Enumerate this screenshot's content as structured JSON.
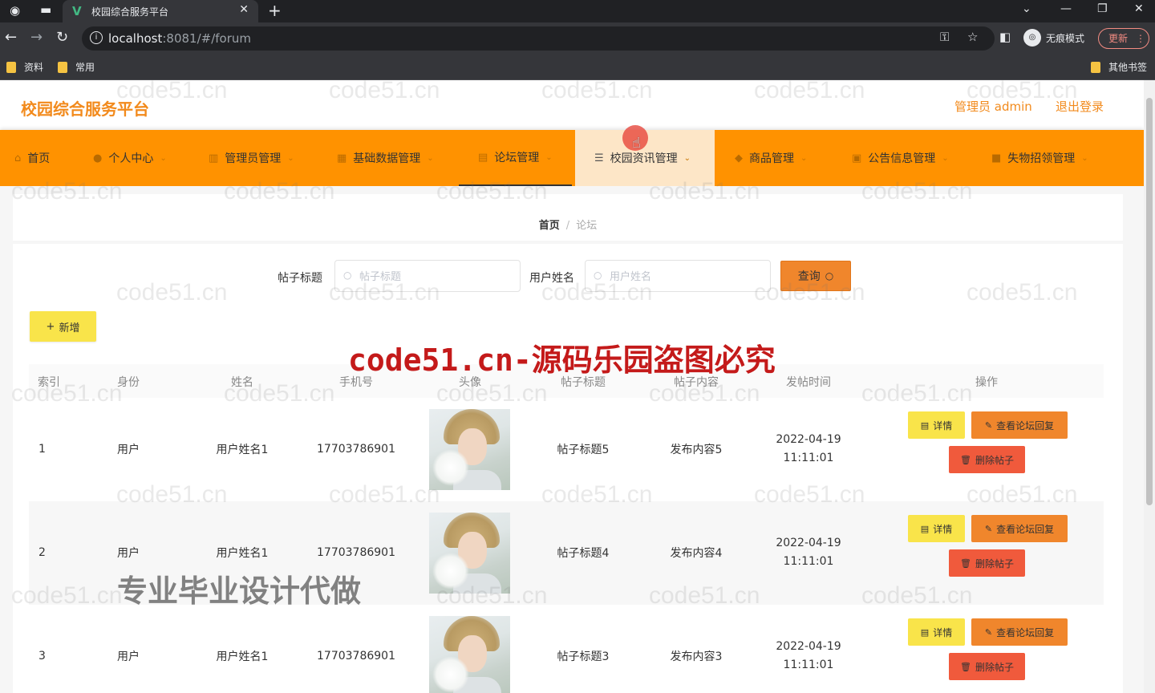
{
  "browser": {
    "tab_title": "校园综合服务平台",
    "url_host": "localhost",
    "url_rest": ":8081/#/forum",
    "incognito_label": "无痕模式",
    "update_label": "更新",
    "bookmarks": [
      "资料",
      "常用"
    ],
    "other_bookmarks": "其他书签"
  },
  "header": {
    "site_title": "校园综合服务平台",
    "admin_label": "管理员 admin",
    "logout_label": "退出登录"
  },
  "menu": [
    {
      "label": "首页"
    },
    {
      "label": "个人中心"
    },
    {
      "label": "管理员管理"
    },
    {
      "label": "基础数据管理"
    },
    {
      "label": "论坛管理"
    },
    {
      "label": "校园资讯管理"
    },
    {
      "label": "商品管理"
    },
    {
      "label": "公告信息管理"
    },
    {
      "label": "失物招领管理"
    }
  ],
  "breadcrumb": {
    "home": "首页",
    "separator": "/",
    "current": "论坛"
  },
  "search": {
    "title_label": "帖子标题",
    "title_placeholder": "帖子标题",
    "name_label": "用户姓名",
    "name_placeholder": "用户姓名",
    "query_label": "查询"
  },
  "add_label": "新增",
  "table": {
    "headers": [
      "索引",
      "身份",
      "姓名",
      "手机号",
      "头像",
      "帖子标题",
      "帖子内容",
      "发帖时间",
      "操作"
    ],
    "rows": [
      {
        "index": "1",
        "role": "用户",
        "name": "用户姓名1",
        "phone": "17703786901",
        "title": "帖子标题5",
        "content": "发布内容5",
        "time": "2022-04-19 11:11:01"
      },
      {
        "index": "2",
        "role": "用户",
        "name": "用户姓名1",
        "phone": "17703786901",
        "title": "帖子标题4",
        "content": "发布内容4",
        "time": "2022-04-19 11:11:01"
      },
      {
        "index": "3",
        "role": "用户",
        "name": "用户姓名1",
        "phone": "17703786901",
        "title": "帖子标题3",
        "content": "发布内容3",
        "time": "2022-04-19 11:11:01"
      }
    ],
    "actions": {
      "detail": "详情",
      "reply": "查看论坛回复",
      "delete": "删除帖子"
    }
  },
  "watermarks": {
    "site": "code51.cn",
    "banner": "code51.cn-源码乐园盗图必究",
    "ad": "专业毕业设计代做"
  },
  "colors": {
    "accent": "#ff9200",
    "title": "#f28a1c",
    "query": "#f0862c",
    "add": "#f9e44a",
    "delete": "#f05a3c"
  }
}
